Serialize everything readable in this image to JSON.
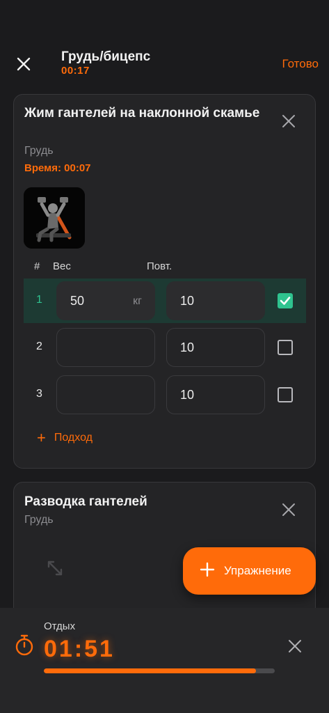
{
  "header": {
    "title": "Грудь/бицепс",
    "timer": "00:17",
    "done_label": "Готово"
  },
  "exercises": [
    {
      "name": "Жим гантелей на наклонной скамье",
      "muscle": "Грудь",
      "time": "Время: 00:07",
      "col_num": "#",
      "col_weight": "Вес",
      "col_reps": "Повт.",
      "sets": [
        {
          "num": "1",
          "weight": "50",
          "unit": "кг",
          "reps": "10",
          "completed": true
        },
        {
          "num": "2",
          "weight": "",
          "unit": "",
          "reps": "10",
          "completed": false
        },
        {
          "num": "3",
          "weight": "",
          "unit": "",
          "reps": "10",
          "completed": false
        }
      ],
      "add_set_label": "Подход"
    },
    {
      "name": "Разводка гантелей",
      "muscle": "Грудь"
    }
  ],
  "fab": {
    "label": "Упражнение"
  },
  "rest": {
    "label": "Отдых",
    "time": "01:51",
    "progress": 0.92
  },
  "colors": {
    "accent": "#ff6b0a",
    "success": "#2fc38f",
    "background": "#1b1b1d",
    "card": "#242426"
  }
}
